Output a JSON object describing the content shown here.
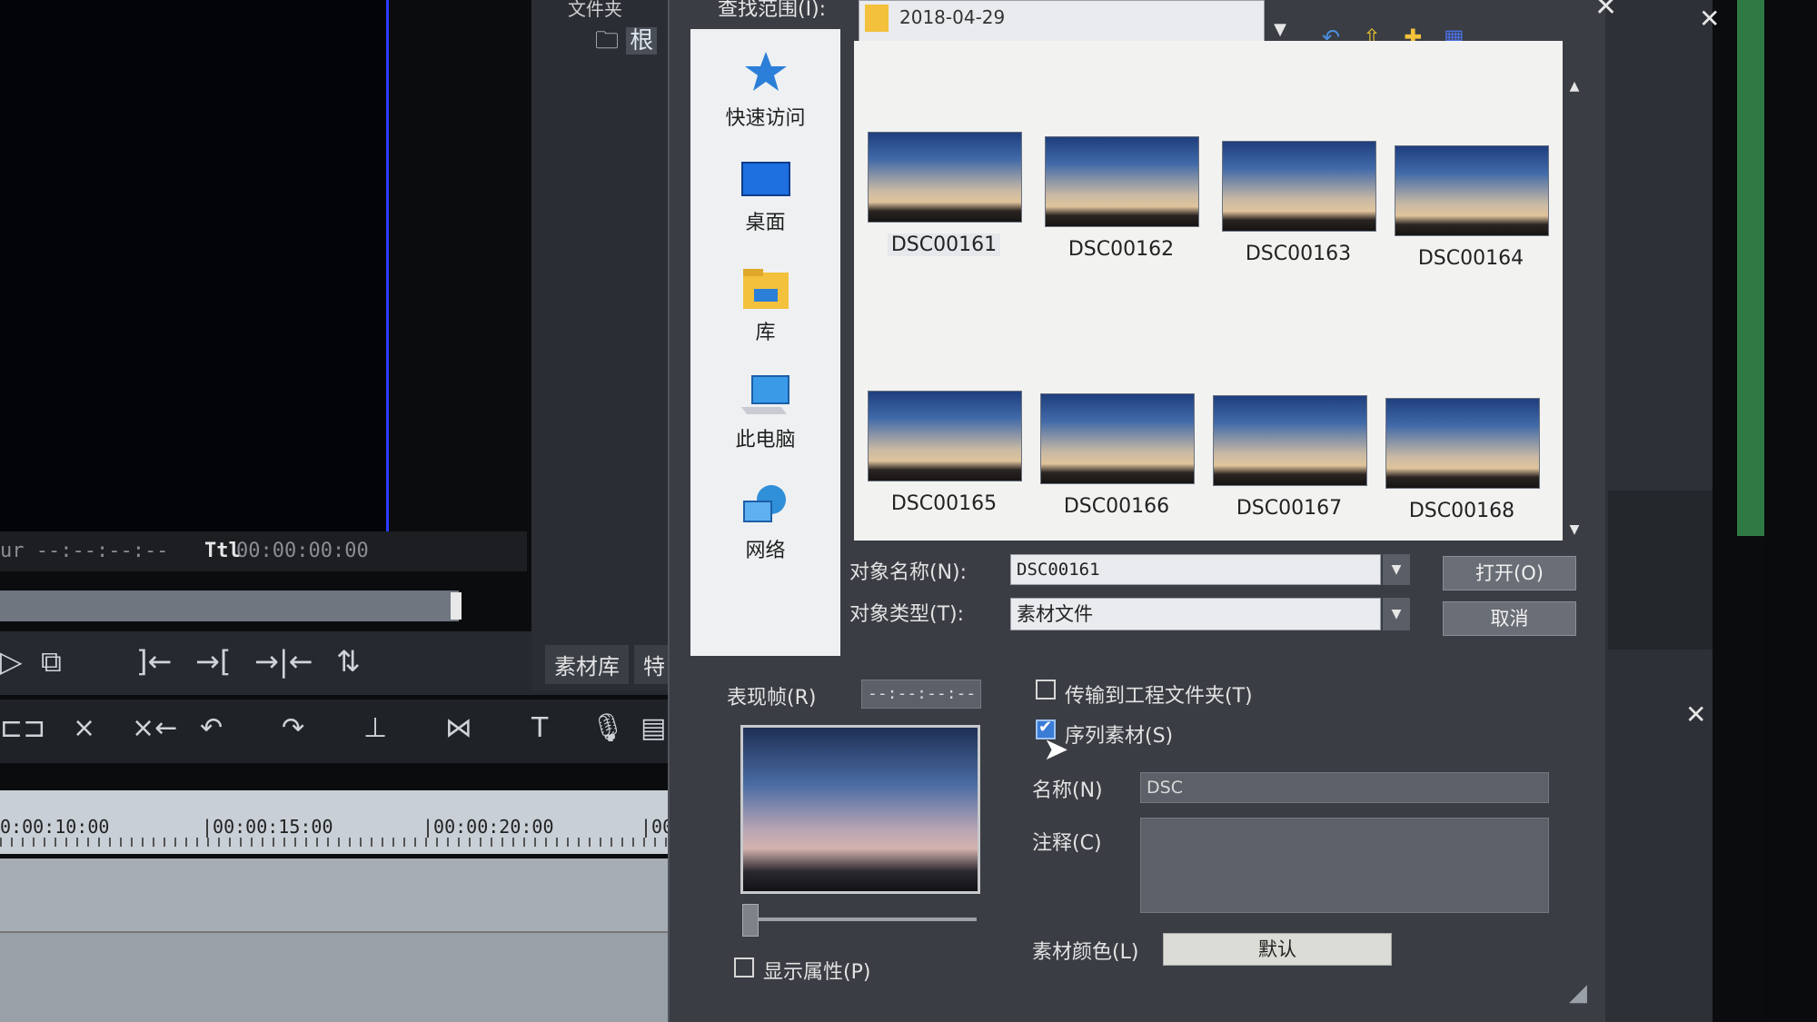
{
  "app": {
    "folder_pane_title": "文件夹",
    "folder_pane_root": "根",
    "timecode_cur_label": "ur --:--:--:--",
    "timecode_ttl_label": "Ttl",
    "timecode_ttl_value": "00:00:00:00",
    "bin_tabs": [
      "素材库",
      "特"
    ],
    "ruler_ticks": [
      "0:00:10:00",
      "|00:00:15:00",
      "|00:00:20:00",
      "|00"
    ]
  },
  "dialog": {
    "lookin_label": "查找范围(I):",
    "lookin_value": "2018-04-29",
    "places": [
      {
        "label": "快速访问",
        "icon": "star-icon"
      },
      {
        "label": "桌面",
        "icon": "desktop-icon"
      },
      {
        "label": "库",
        "icon": "library-icon"
      },
      {
        "label": "此电脑",
        "icon": "computer-icon"
      },
      {
        "label": "网络",
        "icon": "network-icon"
      }
    ],
    "files": [
      "DSC00161",
      "DSC00162",
      "DSC00163",
      "DSC00164",
      "DSC00165",
      "DSC00166",
      "DSC00167",
      "DSC00168"
    ],
    "selected_file": "DSC00161",
    "object_name_label": "对象名称(N):",
    "object_name_value": "DSC00161",
    "object_type_label": "对象类型(T):",
    "object_type_value": "素材文件",
    "open_button": "打开(O)",
    "cancel_button": "取消",
    "frame_label": "表现帧(R)",
    "frame_value": "--:--:--:--",
    "transfer_checkbox": "传输到工程文件夹(T)",
    "transfer_checked": false,
    "sequence_checkbox": "序列素材(S)",
    "sequence_checked": true,
    "name_label": "名称(N)",
    "name_value": "DSC",
    "comment_label": "注释(C)",
    "comment_value": "",
    "color_label": "素材颜色(L)",
    "color_button": "默认",
    "show_props_checkbox": "显示属性(P)",
    "show_props_checked": false
  },
  "colors": {
    "accent_blue": "#2a3cff",
    "folder_yellow": "#f3c13b",
    "dialog_bg": "#3a3d43"
  }
}
